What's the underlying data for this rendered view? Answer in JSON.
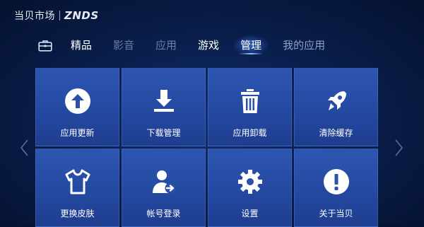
{
  "header": {
    "logo_cn": "当贝市场",
    "logo_en": "ZNDS"
  },
  "nav": {
    "icon": "briefcase-icon",
    "tabs": [
      {
        "label": "精品"
      },
      {
        "label": "影音"
      },
      {
        "label": "应用"
      },
      {
        "label": "游戏"
      },
      {
        "label": "管理"
      },
      {
        "label": "我的应用"
      }
    ],
    "active": "管理"
  },
  "tiles": [
    {
      "label": "应用更新",
      "icon": "arrow-up-circle-icon"
    },
    {
      "label": "下载管理",
      "icon": "download-icon"
    },
    {
      "label": "应用卸载",
      "icon": "trash-icon"
    },
    {
      "label": "清除缓存",
      "icon": "rocket-icon"
    },
    {
      "label": "更换皮肤",
      "icon": "shirt-icon"
    },
    {
      "label": "帐号登录",
      "icon": "user-login-icon"
    },
    {
      "label": "设置",
      "icon": "gear-icon"
    },
    {
      "label": "关于当贝",
      "icon": "info-exclamation-icon"
    }
  ],
  "colors": {
    "tile": "#2a51aa",
    "background": "#0a1f4e",
    "icon": "#ffffff"
  }
}
